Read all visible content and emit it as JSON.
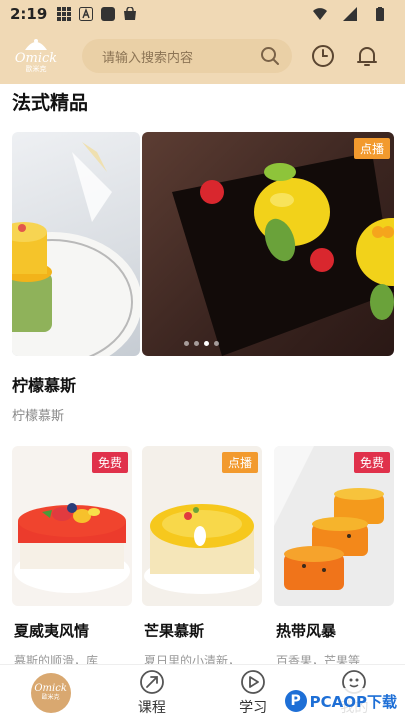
{
  "status_bar": {
    "time": "2:19",
    "icons": [
      "grid-icon",
      "a-box-icon",
      "square-icon",
      "bag-icon",
      "wifi-icon",
      "signal-icon",
      "battery-icon"
    ]
  },
  "header": {
    "logo_text": "Omick",
    "logo_sub": "歐米克",
    "search_placeholder": "请输入搜索内容",
    "icons": [
      "search-icon",
      "clock-icon",
      "bell-icon"
    ]
  },
  "section": {
    "title": "法式精品"
  },
  "banner": {
    "badge": "点播",
    "title": "柠檬慕斯",
    "subtitle": "柠檬慕斯",
    "dots": 4,
    "active_dot": 2
  },
  "grid": {
    "items": [
      {
        "badge": "免费",
        "badge_color": "#e0314b",
        "title": "夏威夷风情",
        "desc": "慕斯的顺滑，库"
      },
      {
        "badge": "点播",
        "badge_color": "#f29a2e",
        "title": "芒果慕斯",
        "desc": "夏日里的小清新，"
      },
      {
        "badge": "免费",
        "badge_color": "#e0314b",
        "title": "热带风暴",
        "desc": "百香果，芒果等"
      }
    ]
  },
  "bottom_nav": {
    "items": [
      {
        "label": "",
        "icon": "home-logo-icon"
      },
      {
        "label": "课程",
        "icon": "course-icon"
      },
      {
        "label": "学习",
        "icon": "play-icon"
      },
      {
        "label": "我的",
        "icon": "profile-icon"
      }
    ]
  },
  "watermark": {
    "badge": "P",
    "text": "PCAOP下载"
  },
  "colors": {
    "header_bg": "#f0d9b5",
    "search_bg": "#ead0a6",
    "accent": "#d9a870",
    "badge_orange": "#f29a2e",
    "badge_red": "#e0314b"
  }
}
